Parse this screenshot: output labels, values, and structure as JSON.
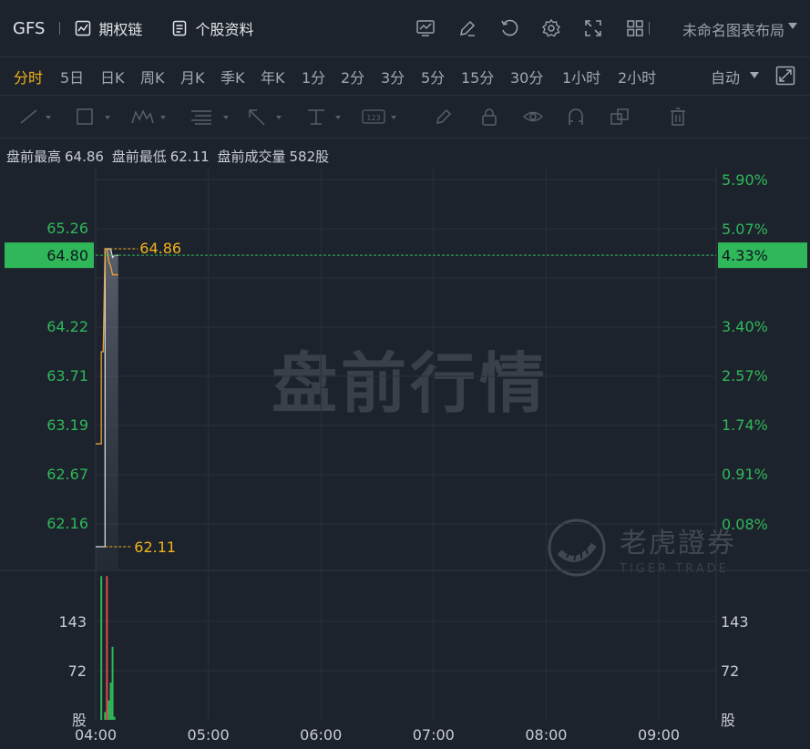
{
  "header": {
    "ticker": "GFS",
    "options_chain_label": "期权链",
    "profile_label": "个股资料",
    "layout_name": "未命名图表布局"
  },
  "periods": [
    "分时",
    "5日",
    "日K",
    "周K",
    "月K",
    "季K",
    "年K",
    "1分",
    "2分",
    "3分",
    "5分",
    "15分",
    "30分",
    "1小时",
    "2小时"
  ],
  "active_period": "分时",
  "scale_mode": "自动",
  "premarket": {
    "high_label": "盘前最高",
    "high": "64.86",
    "low_label": "盘前最低",
    "low": "62.11",
    "volume_label": "盘前成交量",
    "volume": "582股"
  },
  "watermark": "盘前行情",
  "logo": {
    "cn": "老虎證券",
    "en": "TIGER TRADE"
  },
  "colors": {
    "accent": "#f3b21c",
    "up": "#2fb75a",
    "down": "#e04b4b",
    "background": "#1d232d"
  },
  "chart_data": {
    "type": "line",
    "price_axis_labels": [
      "65.26",
      "64.80",
      "64.22",
      "63.71",
      "63.19",
      "62.67",
      "62.16"
    ],
    "percent_axis_labels": [
      "5.90%",
      "5.07%",
      "4.33%",
      "3.40%",
      "2.57%",
      "1.74%",
      "0.91%",
      "0.08%"
    ],
    "volume_axis_labels": [
      "143",
      "72",
      "股"
    ],
    "x_labels": [
      "04:00",
      "05:00",
      "06:00",
      "07:00",
      "08:00",
      "09:00"
    ],
    "current_price": "64.80",
    "current_percent": "4.33%",
    "high_marker": "64.86",
    "low_marker": "62.11",
    "price_ylim": [
      61.9,
      65.6
    ],
    "price": [
      {
        "t": "04:00",
        "v": 62.11
      },
      {
        "t": "04:05",
        "v": 62.11
      },
      {
        "t": "04:05",
        "v": 64.86
      },
      {
        "t": "04:08",
        "v": 64.86
      },
      {
        "t": "04:09",
        "v": 64.78
      },
      {
        "t": "04:10",
        "v": 64.8
      },
      {
        "t": "04:12",
        "v": 64.8
      }
    ],
    "avg": [
      {
        "t": "04:00",
        "v": 63.06
      },
      {
        "t": "04:03",
        "v": 63.06
      },
      {
        "t": "04:03",
        "v": 63.91
      },
      {
        "t": "04:04",
        "v": 63.91
      },
      {
        "t": "04:05",
        "v": 64.86
      },
      {
        "t": "04:06",
        "v": 64.86
      },
      {
        "t": "04:07",
        "v": 64.74
      },
      {
        "t": "04:08",
        "v": 64.7
      },
      {
        "t": "04:09",
        "v": 64.62
      },
      {
        "t": "04:12",
        "v": 64.62
      }
    ],
    "volume_ylim": [
      0,
      190
    ],
    "volume": [
      {
        "t": "04:03",
        "v": 185,
        "dir": "up"
      },
      {
        "t": "04:05",
        "v": 10,
        "dir": "up"
      },
      {
        "t": "04:06",
        "v": 185,
        "dir": "down"
      },
      {
        "t": "04:07",
        "v": 25,
        "dir": "up"
      },
      {
        "t": "04:08",
        "v": 48,
        "dir": "up"
      },
      {
        "t": "04:09",
        "v": 94,
        "dir": "up"
      },
      {
        "t": "04:10",
        "v": 4,
        "dir": "up"
      }
    ]
  }
}
